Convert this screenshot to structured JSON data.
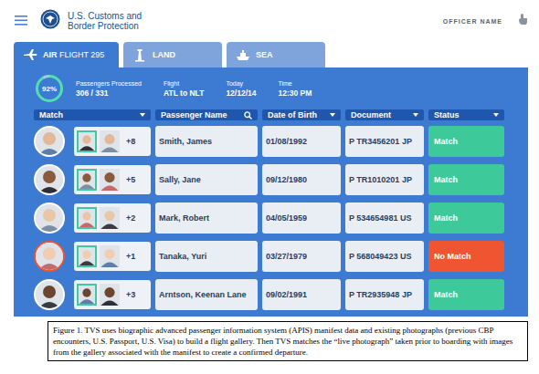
{
  "header": {
    "brand_line1": "U.S. Customs and",
    "brand_line2": "Border Protection",
    "officer": "OFFICER NAME"
  },
  "tabs": [
    {
      "label": "AIR",
      "sublabel": "FLIGHT 295",
      "kind": "air",
      "selected": true
    },
    {
      "label": "LAND",
      "sublabel": "",
      "kind": "land",
      "selected": false
    },
    {
      "label": "SEA",
      "sublabel": "",
      "kind": "sea",
      "selected": false
    }
  ],
  "summary": {
    "progress": {
      "reading": "92%",
      "level": 0.92
    },
    "items": [
      {
        "label": "Passengers Processed",
        "value": "306 / 331"
      },
      {
        "label": "Flight",
        "value": "ATL to NLT"
      },
      {
        "label": "Today",
        "value": "12/12/14"
      },
      {
        "label": "Time",
        "value": "12:30 PM"
      }
    ]
  },
  "table": {
    "columns": [
      {
        "label": "Match",
        "kind": "dropdown"
      },
      {
        "label": "Passenger Name",
        "kind": "search"
      },
      {
        "label": "Date of Birth",
        "kind": "dropdown"
      },
      {
        "label": "Document",
        "kind": "dropdown"
      },
      {
        "label": "Status",
        "kind": "dropdown"
      }
    ],
    "rows": [
      {
        "extra": "+8",
        "name": "Smith, James",
        "dob": "01/08/1992",
        "document": "P TR3456201 JP",
        "status": "Match",
        "match": true,
        "color": "#3ec99b"
      },
      {
        "extra": "+5",
        "name": "Sally, Jane",
        "dob": "09/12/1980",
        "document": "P TR1010201 JP",
        "status": "Match",
        "match": true,
        "color": "#3ec99b"
      },
      {
        "extra": "+2",
        "name": "Mark, Robert",
        "dob": "04/05/1959",
        "document": "P 534654981 US",
        "status": "Match",
        "match": true,
        "color": "#3ec99b"
      },
      {
        "extra": "+1",
        "name": "Tanaka, Yuri",
        "dob": "03/27/1979",
        "document": "P 568049423 US",
        "status": "No Match",
        "match": false,
        "color": "#ef5530"
      },
      {
        "extra": "+3",
        "name": "Arntson, Keenan Lane",
        "dob": "09/02/1991",
        "document": "P TR2935948 JP",
        "status": "Match",
        "match": true,
        "color": "#3ec99b"
      }
    ]
  },
  "caption": "Figure 1. TVS uses biographic advanced passenger information system (APIS) manifest data and existing photographs (previous CBP encounters, U.S. Passport, U.S. Visa) to build a flight gallery. Then TVS matches the “live photograph” taken prior to boarding with images from the gallery associated with the manifest to create a confirmed departure."
}
